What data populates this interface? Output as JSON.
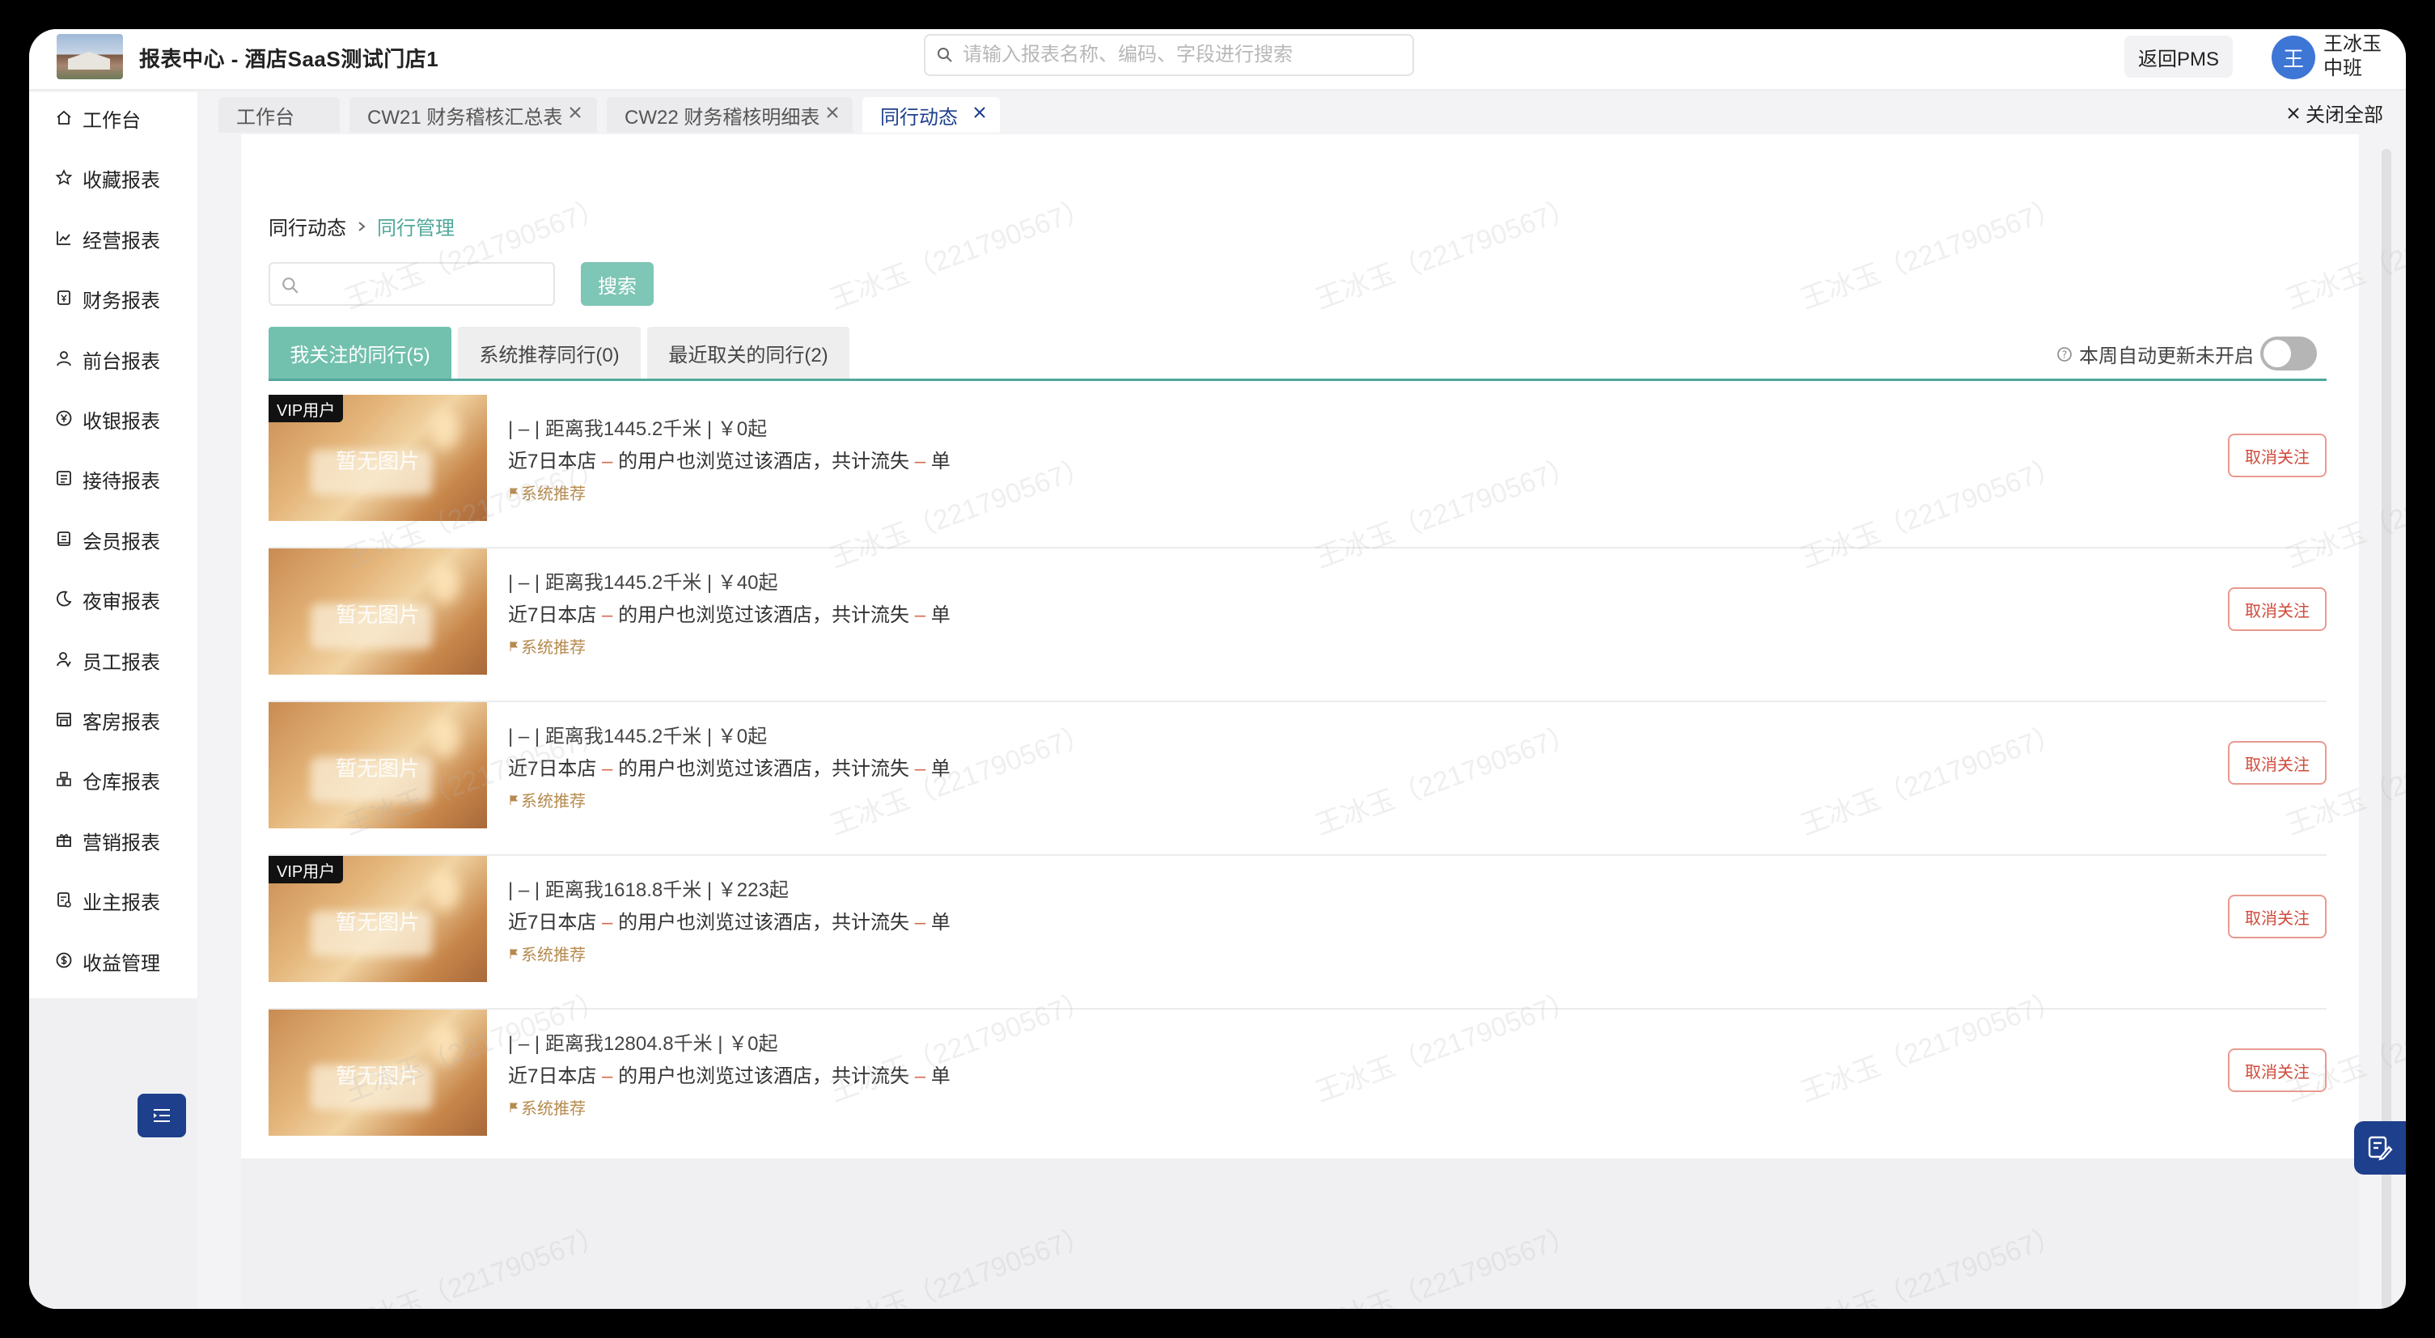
{
  "header": {
    "title": "报表中心 - 酒店SaaS测试门店1",
    "search_placeholder": "请输入报表名称、编码、字段进行搜索",
    "back_label": "返回PMS",
    "avatar_initial": "王",
    "user_name": "王冰玉",
    "user_shift": "中班"
  },
  "sidebar": {
    "items": [
      {
        "label": "工作台",
        "icon": "home-icon"
      },
      {
        "label": "收藏报表",
        "icon": "star-icon"
      },
      {
        "label": "经营报表",
        "icon": "line-chart-icon"
      },
      {
        "label": "财务报表",
        "icon": "finance-doc-icon"
      },
      {
        "label": "前台报表",
        "icon": "user-icon"
      },
      {
        "label": "收银报表",
        "icon": "yen-circle-icon"
      },
      {
        "label": "接待报表",
        "icon": "reception-icon"
      },
      {
        "label": "会员报表",
        "icon": "member-card-icon"
      },
      {
        "label": "夜审报表",
        "icon": "moon-icon"
      },
      {
        "label": "员工报表",
        "icon": "staff-icon"
      },
      {
        "label": "客房报表",
        "icon": "room-icon"
      },
      {
        "label": "仓库报表",
        "icon": "warehouse-icon"
      },
      {
        "label": "营销报表",
        "icon": "gift-icon"
      },
      {
        "label": "业主报表",
        "icon": "owner-doc-icon"
      },
      {
        "label": "收益管理",
        "icon": "dollar-circle-icon"
      }
    ]
  },
  "tabs": [
    {
      "label": "工作台",
      "closable": false,
      "active": false
    },
    {
      "label": "CW21 财务稽核汇总表",
      "closable": true,
      "active": false
    },
    {
      "label": "CW22 财务稽核明细表",
      "closable": true,
      "active": false
    },
    {
      "label": "同行动态",
      "closable": true,
      "active": true
    }
  ],
  "close_all_label": "关闭全部",
  "breadcrumb": {
    "parent": "同行动态",
    "current": "同行管理"
  },
  "search": {
    "value": "",
    "button_label": "搜索"
  },
  "sub_tabs": [
    {
      "label": "我关注的同行(5)",
      "active": true
    },
    {
      "label": "系统推荐同行(0)",
      "active": false
    },
    {
      "label": "最近取关的同行(2)",
      "active": false
    }
  ],
  "auto_update_label": "本周自动更新未开启",
  "auto_update_on": false,
  "list": [
    {
      "vip": "VIP用户",
      "no_image": "暂无图片",
      "line1": "| – | 距离我1445.2千米 | ￥0起",
      "line2_prefix": "近7日本店",
      "line2_mid": "的用户也浏览过该酒店，共计流失",
      "line2_suffix": "单",
      "dash": "–",
      "tag": "系统推荐",
      "action": "取消关注"
    },
    {
      "vip": "",
      "no_image": "暂无图片",
      "line1": "| – | 距离我1445.2千米 | ￥40起",
      "line2_prefix": "近7日本店",
      "line2_mid": "的用户也浏览过该酒店，共计流失",
      "line2_suffix": "单",
      "dash": "–",
      "tag": "系统推荐",
      "action": "取消关注"
    },
    {
      "vip": "",
      "no_image": "暂无图片",
      "line1": "| – | 距离我1445.2千米 | ￥0起",
      "line2_prefix": "近7日本店",
      "line2_mid": "的用户也浏览过该酒店，共计流失",
      "line2_suffix": "单",
      "dash": "–",
      "tag": "系统推荐",
      "action": "取消关注"
    },
    {
      "vip": "VIP用户",
      "no_image": "暂无图片",
      "line1": "| – | 距离我1618.8千米 | ￥223起",
      "line2_prefix": "近7日本店",
      "line2_mid": "的用户也浏览过该酒店，共计流失",
      "line2_suffix": "单",
      "dash": "–",
      "tag": "系统推荐",
      "action": "取消关注"
    },
    {
      "vip": "",
      "no_image": "暂无图片",
      "line1": "| – | 距离我12804.8千米 | ￥0起",
      "line2_prefix": "近7日本店",
      "line2_mid": "的用户也浏览过该酒店，共计流失",
      "line2_suffix": "单",
      "dash": "–",
      "tag": "系统推荐",
      "action": "取消关注"
    }
  ],
  "watermark": "王冰玉（221790567）",
  "colors": {
    "brand": "#1d3f8c",
    "accent": "#4fa89a",
    "danger": "#d04a3a"
  }
}
